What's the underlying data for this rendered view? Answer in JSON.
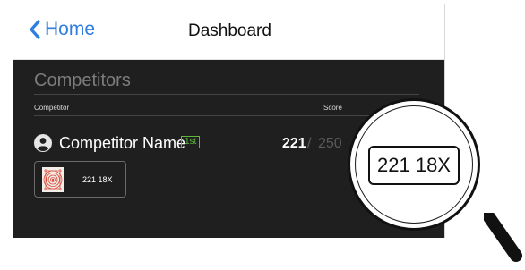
{
  "nav": {
    "back_label": "Home",
    "title": "Dashboard"
  },
  "competitors": {
    "heading": "Competitors",
    "col_competitor": "Competitor",
    "col_score": "Score",
    "rows": [
      {
        "name": "Competitor Name",
        "rank": "1st",
        "score": "221",
        "separator": "/",
        "max": "250",
        "target": {
          "label": "221 18X"
        }
      }
    ]
  },
  "magnifier": {
    "text": "221 18X"
  },
  "colors": {
    "accent": "#2f7de1",
    "rank_green": "#5eb93a",
    "dark_bg": "#1f1f1f",
    "target_red": "#d94a3a"
  },
  "icons": {
    "back": "chevron-left-icon",
    "user": "user-circle-icon",
    "target": "target-thumbnail-icon",
    "magnifier": "magnifying-glass-icon"
  }
}
